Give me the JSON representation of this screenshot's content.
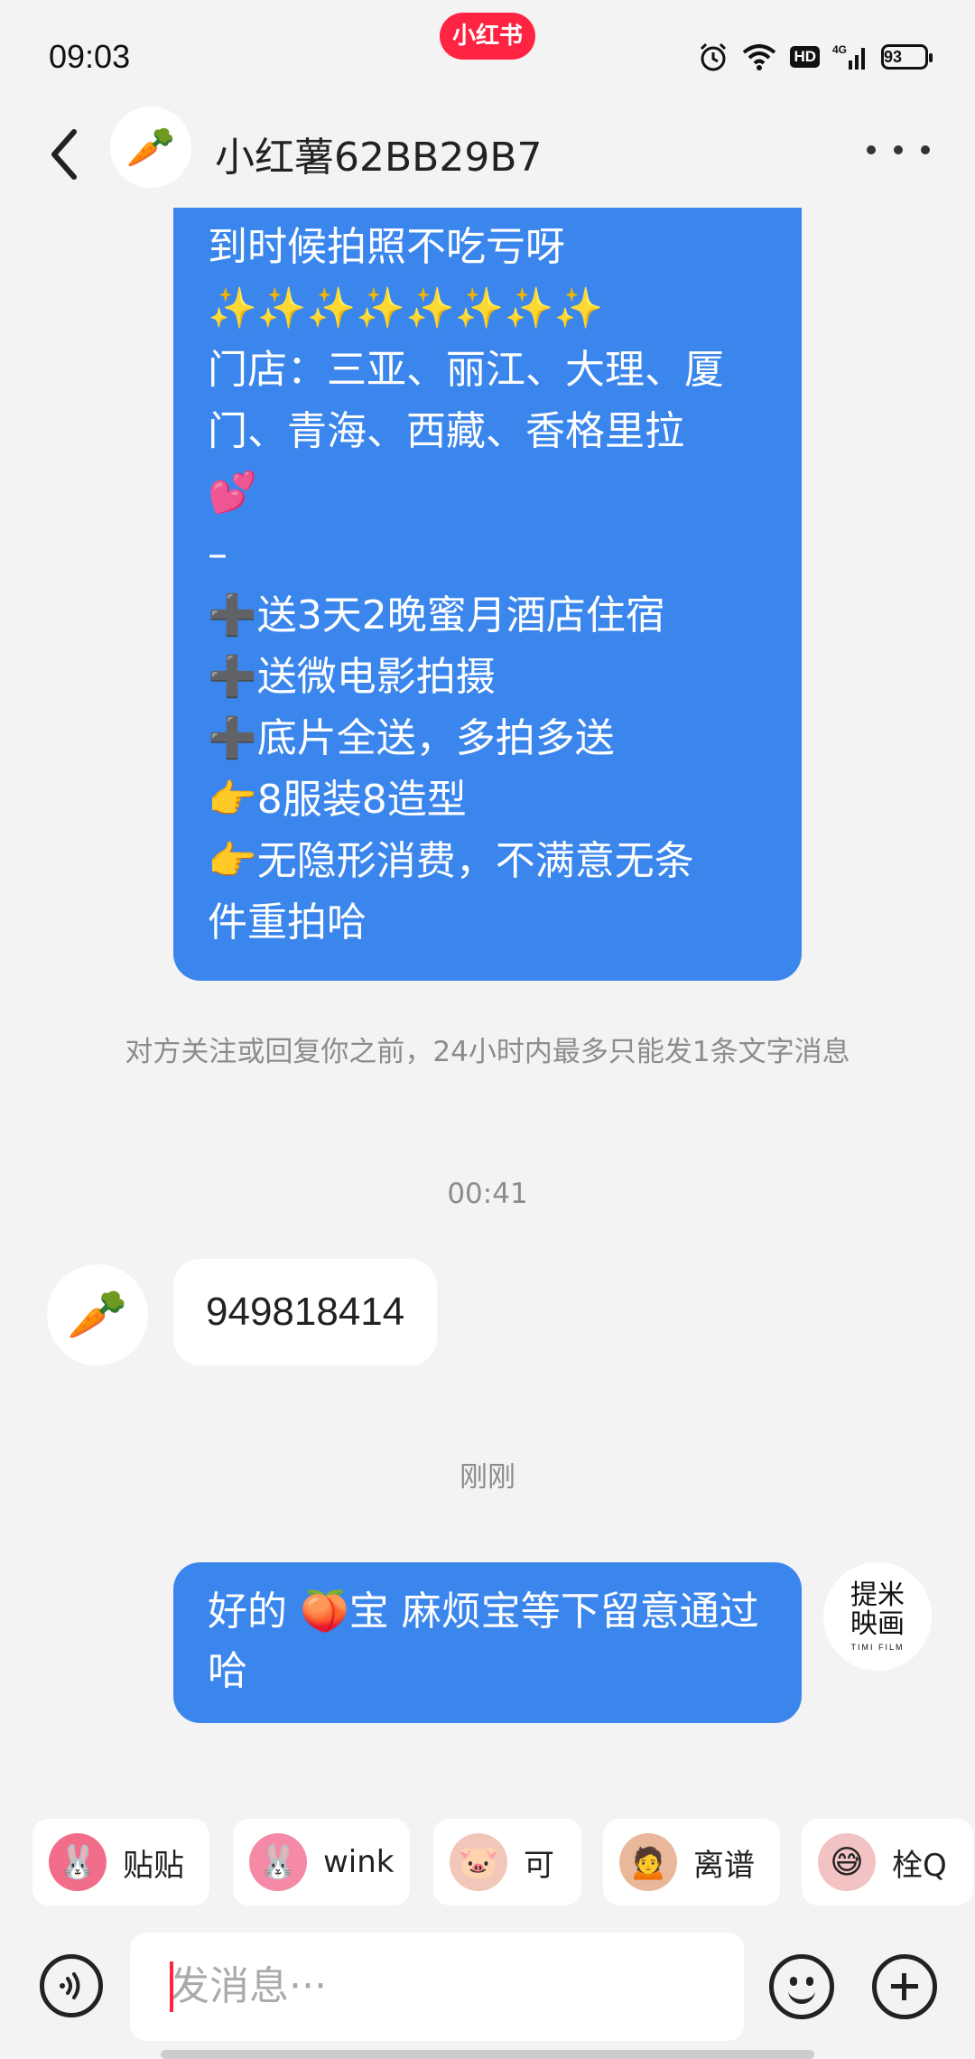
{
  "status": {
    "time": "09:03",
    "app_badge": "小红书",
    "hd": "HD",
    "network": "4G",
    "battery": "93"
  },
  "header": {
    "avatar_icon": "carrot-icon",
    "title": "小红薯62BB29B7"
  },
  "messages": {
    "long_sent_lines": [
      "到时候拍照不吃亏呀",
      "✨✨✨✨✨✨✨✨",
      "门店：三亚、丽江、大理、厦",
      "门、青海、西藏、香格里拉",
      "💕",
      "–",
      "➕送3天2晚蜜月酒店住宿",
      "➕送微电影拍摄",
      "➕底片全送，多拍多送",
      "👉8服装8造型",
      "👉无隐形消费，不满意无条",
      "件重拍哈"
    ],
    "system_note": "对方关注或回复你之前，24小时内最多只能发1条文字消息",
    "timestamp_1": "00:41",
    "received_text": "949818414",
    "timestamp_2": "刚刚",
    "sent_text": "好的 🍑宝  麻烦宝等下留意通过哈",
    "my_avatar_line1": "提米",
    "my_avatar_line2": "映画",
    "my_avatar_sub": "TIMI FILM"
  },
  "stickers": [
    {
      "label": "贴贴",
      "color": "#f26d8a",
      "emoji": "🐰"
    },
    {
      "label": "wink",
      "color": "#f58aa6",
      "emoji": "🐰"
    },
    {
      "label": "可",
      "color": "#f0c7b8",
      "emoji": "🐷"
    },
    {
      "label": "离谱",
      "color": "#e9b89a",
      "emoji": "🙍"
    },
    {
      "label": "栓Q",
      "color": "#f3c2c2",
      "emoji": "😅"
    }
  ],
  "input": {
    "placeholder": "发消息···"
  }
}
